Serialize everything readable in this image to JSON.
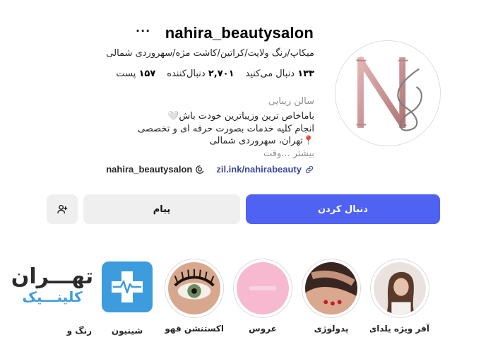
{
  "profile": {
    "username": "nahira_beautysalon",
    "more_glyph": "···",
    "category_line": "میکاپ/رنگ ولایت/کراتین/کاشت مژه/سهروردی شمالی",
    "stats": {
      "posts": {
        "count": "۱۵۷",
        "label": "پست"
      },
      "followers": {
        "count": "۲,۷۰۱",
        "label": "دنبال‌کننده"
      },
      "following": {
        "count": "۱۳۳",
        "label": "دنبال می‌کنید"
      }
    },
    "category_label": "سالن زیبایی",
    "bio": [
      "باماخاص ترین وزیباترین خودت باش🤍",
      "انجام کلیه خدمات بصورت حرفه ای و تخصصی",
      "📍تهران، سهروردی شمالی",
      "بیشتر ...وقت"
    ],
    "link_url": "zil.ink/nahirabeauty",
    "threads_handle": "nahira_beautysalon",
    "avatar_monogram": "NB"
  },
  "actions": {
    "follow_label": "دنبال کردن",
    "message_label": "پیام",
    "suggest_icon": "person-add-icon"
  },
  "highlights": [
    {
      "label": "آفر ویژه یلدای..."
    },
    {
      "label": "پدولوژی"
    },
    {
      "label": "عروس"
    },
    {
      "label": "اکستنشن قهو..."
    },
    {
      "label": "شینیون"
    },
    {
      "label": "رنگ و لا"
    }
  ],
  "overlay": {
    "line1": "تهـــران",
    "line2": "کلینـــیک"
  },
  "colors": {
    "follow_button": "#4f62f2",
    "link": "#3b4a9e",
    "clinic_blue": "#3d9cde",
    "monogram": "#c08a8a"
  }
}
